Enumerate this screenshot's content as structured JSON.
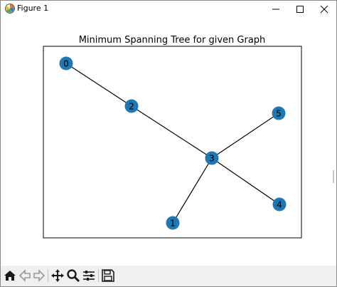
{
  "window": {
    "title": "Figure 1",
    "controls": [
      "minimize-icon",
      "maximize-icon",
      "close-icon"
    ]
  },
  "figure": {
    "title": "Minimum Spanning Tree for given Graph",
    "node_color": "#1f77b4",
    "edge_color": "#000000",
    "nodes": [
      "0",
      "1",
      "2",
      "3",
      "4",
      "5"
    ],
    "edges": [
      [
        "0",
        "2"
      ],
      [
        "2",
        "3"
      ],
      [
        "3",
        "5"
      ],
      [
        "3",
        "4"
      ],
      [
        "3",
        "1"
      ]
    ]
  },
  "toolbar": {
    "items": [
      "home-icon",
      "back-icon",
      "forward-icon",
      "pan-icon",
      "zoom-icon",
      "configure-subplots-icon",
      "save-icon"
    ]
  }
}
